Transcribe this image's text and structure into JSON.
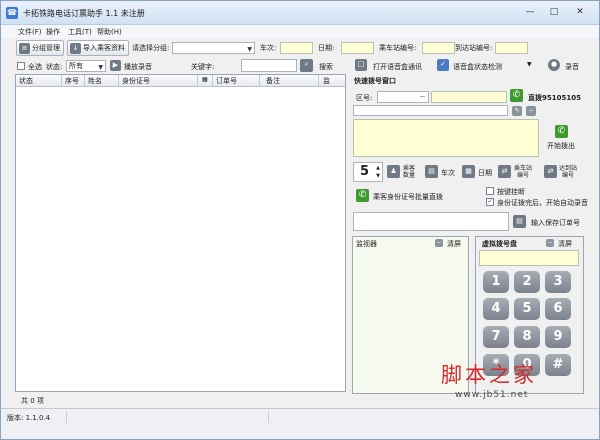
{
  "window": {
    "title": "卡拓铁路电话订票助手 1.1 未注册",
    "min_label": "—",
    "max_label": "□",
    "close_label": "✕"
  },
  "menu": [
    "文件(F)",
    "操作",
    "工具(T)",
    "帮助(H)"
  ],
  "toolbar": {
    "group_manage": "分组管理",
    "import_passengers": "导入乘客资料",
    "select_group_label": "请选择分组:",
    "train_label": "车次:",
    "date_label": "日期:",
    "from_station_label": "乘车站编号:",
    "to_station_label": "到达站编号:",
    "select_all": "全选",
    "status_label": "状态:",
    "status_value": "所有",
    "play_recording": "播放录音",
    "keyword_label": "关键字:",
    "search": "搜索",
    "open_voice_comm": "打开语音盒通讯",
    "voice_box_status": "语音盒状态检测",
    "record": "录音"
  },
  "grid": {
    "columns": [
      "状态",
      "序号",
      "姓名",
      "身份证号",
      "订单号",
      "备注",
      "监"
    ]
  },
  "left_status": "共 0 项",
  "version": "版本: 1.1.0.4",
  "quick_dial": {
    "title": "快速拨号窗口",
    "area_label": "区号:",
    "area_sep": "--",
    "direct_dial": "直拨95105105",
    "start_dial": "开始拨出",
    "count_value": "5",
    "passenger_count": [
      "乘客",
      "数量"
    ],
    "train_btn": "车次",
    "date_btn": "日期",
    "from_btn": [
      "乘车站",
      "编号"
    ],
    "to_btn": [
      "达到站",
      "编号"
    ],
    "batch_dial_id": "乘客身份证号批量直拨",
    "auto_hangup": "按键挂断",
    "auto_record_after_id": "身份证拨完后，开始自动录音",
    "input_save_order": "输入保存订单号"
  },
  "monitor": {
    "title": "监视器",
    "clear": "清屏"
  },
  "dialpad": {
    "title": "虚拟拨号盘",
    "clear": "清屏",
    "keys": [
      "1",
      "2",
      "3",
      "4",
      "5",
      "6",
      "7",
      "8",
      "9",
      "*",
      "0",
      "#"
    ]
  },
  "watermark": {
    "text": "脚本之家",
    "url": "www.jb51.net"
  }
}
